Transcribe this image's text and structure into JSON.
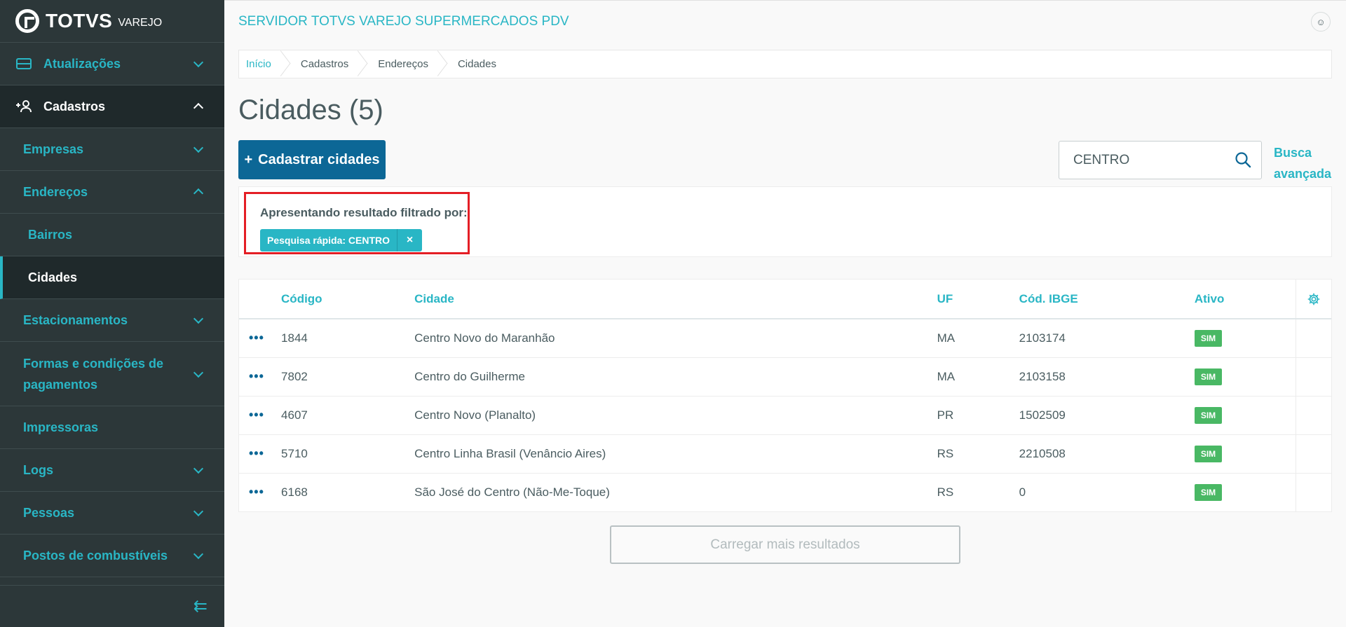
{
  "brand": {
    "name": "TOTVS",
    "sub": "VAREJO"
  },
  "sidebar": {
    "items": [
      {
        "label": "Atualizações"
      },
      {
        "label": "Cadastros"
      },
      {
        "label": "Empresas"
      },
      {
        "label": "Endereços"
      },
      {
        "label": "Bairros"
      },
      {
        "label": "Cidades"
      },
      {
        "label": "Estacionamentos"
      },
      {
        "label": "Formas e condições de pagamentos"
      },
      {
        "label": "Impressoras"
      },
      {
        "label": "Logs"
      },
      {
        "label": "Pessoas"
      },
      {
        "label": "Postos de combustíveis"
      }
    ],
    "collapse_glyph": "⇇"
  },
  "header": {
    "title": "SERVIDOR TOTVS VAREJO SUPERMERCADOS PDV",
    "avatar_glyph": "☺"
  },
  "breadcrumb": [
    "Início",
    "Cadastros",
    "Endereços",
    "Cidades"
  ],
  "page": {
    "title": "Cidades (5)"
  },
  "actions": {
    "add_plus": "+",
    "add_label": "Cadastrar cidades"
  },
  "search": {
    "value": "CENTRO",
    "placeholder": "",
    "advanced_line1": "Busca",
    "advanced_line2": "avançada"
  },
  "filter": {
    "label": "Apresentando resultado filtrado por:",
    "chip": "Pesquisa rápida: CENTRO",
    "chip_close": "×"
  },
  "table": {
    "columns": [
      "Código",
      "Cidade",
      "UF",
      "Cód. IBGE",
      "Ativo"
    ],
    "row_action": "•••",
    "rows": [
      {
        "codigo": "1844",
        "cidade": "Centro Novo do Maranhão",
        "uf": "MA",
        "ibge": "2103174",
        "ativo": "SIM"
      },
      {
        "codigo": "7802",
        "cidade": "Centro do Guilherme",
        "uf": "MA",
        "ibge": "2103158",
        "ativo": "SIM"
      },
      {
        "codigo": "4607",
        "cidade": "Centro Novo (Planalto)",
        "uf": "PR",
        "ibge": "1502509",
        "ativo": "SIM"
      },
      {
        "codigo": "5710",
        "cidade": "Centro Linha Brasil (Venâncio Aires)",
        "uf": "RS",
        "ibge": "2210508",
        "ativo": "SIM"
      },
      {
        "codigo": "6168",
        "cidade": "São José do Centro (Não-Me-Toque)",
        "uf": "RS",
        "ibge": "0",
        "ativo": "SIM"
      }
    ]
  },
  "load_more": "Carregar mais resultados",
  "colors": {
    "accent": "#29b6c5",
    "primary": "#0c6796",
    "sidebar_bg": "#2c3739",
    "success": "#49b864",
    "highlight": "#e41e25"
  },
  "icons": {
    "search": "search-icon",
    "gear": "gear-icon",
    "server": "server-icon",
    "add_user": "add-user-icon"
  }
}
